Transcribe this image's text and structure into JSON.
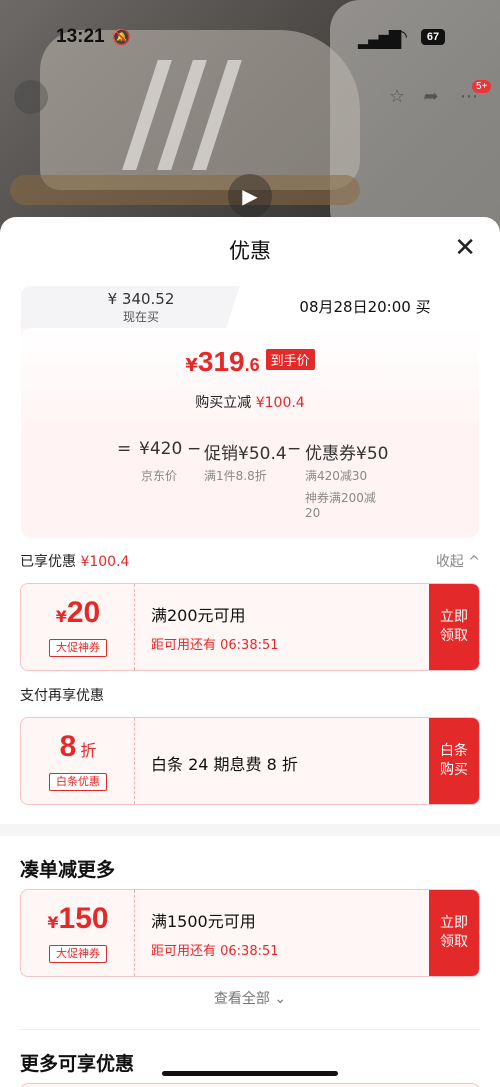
{
  "status_bar": {
    "time": "13:21",
    "battery": "67"
  },
  "product_header": {
    "cart_badge": "5+"
  },
  "sheet": {
    "title": "优惠",
    "price_card": {
      "now_price": "¥ 340.52",
      "now_label": "现在买",
      "future_label": "08月28日20:00 买",
      "final_yen": "¥",
      "final_int": "319",
      "final_dec": ".6",
      "final_tag": "到手价",
      "reduce_label": "购买立减",
      "reduce_value": "¥100.4",
      "calc": {
        "eq": "=",
        "jd_price": "¥420",
        "minus1": "−",
        "promo": "促销¥50.4",
        "minus2": "−",
        "coupon": "优惠券¥50",
        "jd_label": "京东价",
        "promo_sub": "满1件8.8折",
        "coupon_sub1": "满420减30",
        "coupon_sub2": "神券满200减",
        "coupon_sub3": "20"
      }
    },
    "enjoyed": {
      "label": "已享优惠",
      "value": "¥100.4",
      "collapse": "收起 ^"
    },
    "coupon1": {
      "yen": "¥",
      "amount": "20",
      "tag": "大促神券",
      "title": "满200元可用",
      "sub": "距可用还有 06:38:51",
      "button": "立即\n领取"
    },
    "pay_label": "支付再享优惠",
    "coupon2": {
      "amount": "8",
      "unit": "折",
      "tag": "白条优惠",
      "title": "白条 24 期息费 8 折",
      "button": "白条\n购买"
    },
    "more_title": "凑单减更多",
    "coupon3": {
      "yen": "¥",
      "amount": "150",
      "tag": "大促神券",
      "title": "满1500元可用",
      "sub": "距可用还有 06:38:51",
      "button": "立即\n领取"
    },
    "see_all": "查看全部 ⌄",
    "more_benefits": "更多可享优惠"
  }
}
